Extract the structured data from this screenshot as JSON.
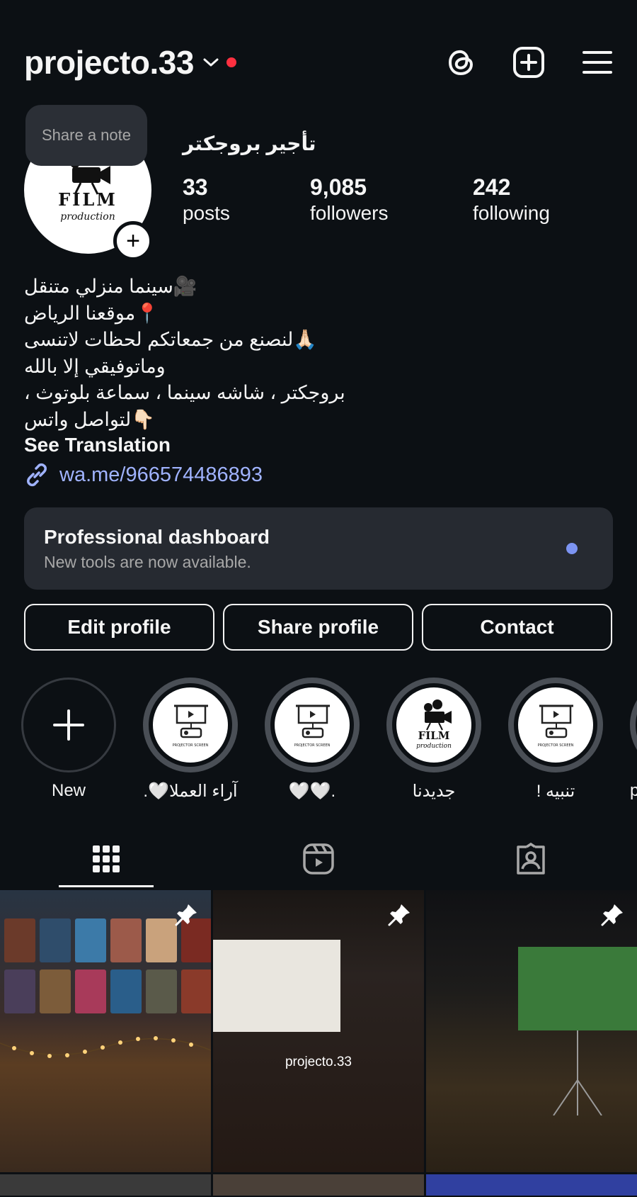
{
  "header": {
    "username": "projecto.33",
    "icons": [
      "threads-icon",
      "create-post-icon",
      "menu-icon"
    ]
  },
  "note": {
    "text": "Share a note"
  },
  "avatar": {
    "text_main": "FILM",
    "text_sub": "production"
  },
  "profile": {
    "full_name": "تأجير بروجكتر",
    "stats": [
      {
        "value": "33",
        "label": "posts"
      },
      {
        "value": "9,085",
        "label": "followers"
      },
      {
        "value": "242",
        "label": "following"
      }
    ]
  },
  "bio": {
    "lines": [
      "🎥سينما منزلي متنقل",
      "📍موقعنا الرياض",
      "🙏🏻لنصنع من جمعاتكم لحظات لاتنسى",
      "وماتوفيقي إلا بالله",
      "بروجكتر ، شاشه سينما ، سماعة بلوتوث ،",
      "👇🏻لتواصل واتس"
    ],
    "see_translation": "See Translation",
    "link": "wa.me/966574486893"
  },
  "dashboard": {
    "title": "Professional dashboard",
    "subtitle": "New tools are now available."
  },
  "actions": {
    "edit": "Edit profile",
    "share": "Share profile",
    "contact": "Contact"
  },
  "highlights": [
    {
      "label": "New",
      "type": "new"
    },
    {
      "label": "آراء العملا🤍.",
      "type": "projector"
    },
    {
      "label": "🤍🤍.",
      "type": "projector"
    },
    {
      "label": "جديدنا",
      "type": "film"
    },
    {
      "label": "تنبيه !",
      "type": "projector"
    },
    {
      "label": "p",
      "type": "projector"
    }
  ],
  "highlight_caption": "PROJECTOR SCREEN",
  "tabs": [
    "grid-icon",
    "reels-icon",
    "tagged-icon"
  ],
  "posts": [
    {
      "pinned": true,
      "caption": ""
    },
    {
      "pinned": true,
      "caption": "projecto.33"
    },
    {
      "pinned": true,
      "caption": ""
    }
  ],
  "colors": {
    "background": "#0c1014",
    "link": "#a0b3ff",
    "notification_dot": "#ff3040",
    "dashboard_dot": "#7c94f2"
  }
}
